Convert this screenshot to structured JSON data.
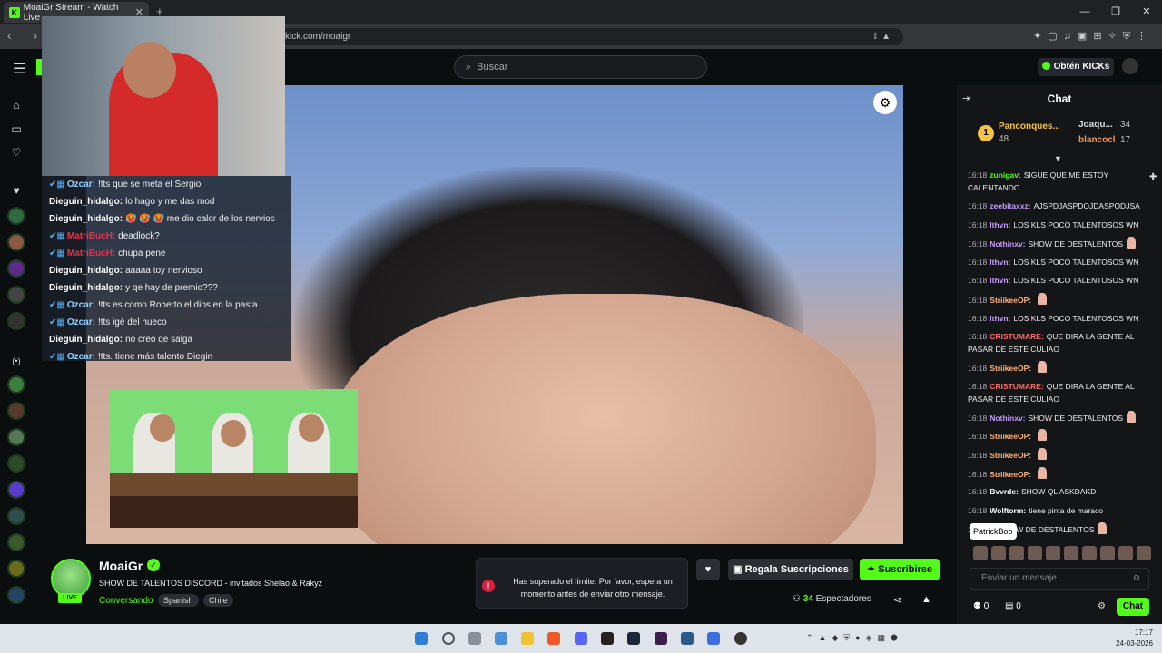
{
  "browser": {
    "tab_title": "MoaiGr Stream - Watch Live",
    "tab_close": "✕",
    "new_tab": "+",
    "url": "kick.com/moaigr",
    "window_controls": [
      "—",
      "❐",
      "✕"
    ]
  },
  "header": {
    "search_placeholder": "Buscar",
    "get_kicks": "Obtén KICKs"
  },
  "overlay_chat": [
    {
      "user": "Ozcar:",
      "text": "!tts que se meta el Sergio",
      "color": "#8fd1ff",
      "badge": true
    },
    {
      "user": "Dieguin_hidalgo:",
      "text": "lo hago y me das mod",
      "color": "#ffffff",
      "badge": false
    },
    {
      "user": "Dieguin_hidalgo:",
      "text": "🥵 🥵 🥵 me dio calor de los nervios",
      "color": "#ffffff",
      "badge": false
    },
    {
      "user": "MatriBucH:",
      "text": "deadlock?",
      "color": "#e2334a",
      "badge": true
    },
    {
      "user": "MatriBucH:",
      "text": "chupa pene",
      "color": "#e2334a",
      "badge": true
    },
    {
      "user": "Dieguin_hidalgo:",
      "text": "aaaaa toy nervioso",
      "color": "#ffffff",
      "badge": false
    },
    {
      "user": "Dieguin_hidalgo:",
      "text": "y qe hay de premio???",
      "color": "#ffffff",
      "badge": false
    },
    {
      "user": "Ozcar:",
      "text": "!tts es como Roberto el dios en la pasta",
      "color": "#8fd1ff",
      "badge": true
    },
    {
      "user": "Ozcar:",
      "text": "!tts igé del hueco",
      "color": "#8fd1ff",
      "badge": true
    },
    {
      "user": "Dieguin_hidalgo:",
      "text": "no creo qe salga",
      "color": "#ffffff",
      "badge": false
    },
    {
      "user": "Ozcar:",
      "text": "!tts. tiene más talento Diegin",
      "color": "#8fd1ff",
      "badge": true
    }
  ],
  "channel": {
    "name": "MoaiGr",
    "live": "LIVE",
    "title": "SHOW DE TALENTOS DISCORD - invitados Shelao & Rakyz",
    "category": "Conversando",
    "tags": [
      "Spanish",
      "Chile"
    ],
    "gift_subs": "Regala Suscripciones",
    "subscribe": "Suscribirse",
    "viewers_count": "34",
    "viewers_label": "Espectadores"
  },
  "toast": {
    "text": "Has superado el límite. Por favor, espera un momento antes de enviar otro mensaje."
  },
  "chat": {
    "title": "Chat",
    "leaderboard": {
      "rank": "1",
      "first_name": "Panconques...",
      "first_count": "48",
      "second_name": "Joaqu...",
      "second_count": "34",
      "third_name": "blancocl",
      "third_count": "17"
    },
    "messages": [
      {
        "time": "16:18",
        "user": "zunigav:",
        "text": "SIGUE QUE ME ESTOY CALENTANDO",
        "color": "#53fc18"
      },
      {
        "time": "16:18",
        "user": "zeebitaxxz:",
        "text": "AJSPDJASPDOJDASPODJSA",
        "color": "#c59bff"
      },
      {
        "time": "16:18",
        "user": "Ithvn:",
        "text": "LOS KLS POCO TALENTOSOS WN",
        "color": "#c59bff"
      },
      {
        "time": "16:18",
        "user": "Nothinxv:",
        "text": "SHOW DE DESTALENTOS",
        "color": "#c59bff"
      },
      {
        "time": "16:18",
        "user": "Ithvn:",
        "text": "LOS KLS POCO TALENTOSOS WN",
        "color": "#c59bff"
      },
      {
        "time": "16:18",
        "user": "Ithvn:",
        "text": "LOS KLS POCO TALENTOSOS WN",
        "color": "#c59bff"
      },
      {
        "time": "16:18",
        "user": "StriikeeOP:",
        "text": "",
        "color": "#ffb27a"
      },
      {
        "time": "16:18",
        "user": "Ithvn:",
        "text": "LOS KLS POCO TALENTOSOS WN",
        "color": "#c59bff"
      },
      {
        "time": "16:18",
        "user": "CRISTUMARE:",
        "text": "QUE DIRA LA GENTE AL PASAR DE ESTE CULIAO",
        "color": "#ff6b6b"
      },
      {
        "time": "16:18",
        "user": "StriikeeOP:",
        "text": "",
        "color": "#ffb27a"
      },
      {
        "time": "16:18",
        "user": "CRISTUMARE:",
        "text": "QUE DIRA LA GENTE AL PASAR DE ESTE CULIAO",
        "color": "#ff6b6b"
      },
      {
        "time": "16:18",
        "user": "Nothinxv:",
        "text": "SHOW DE DESTALENTOS",
        "color": "#c59bff"
      },
      {
        "time": "16:18",
        "user": "StriikeeOP:",
        "text": "",
        "color": "#ffb27a"
      },
      {
        "time": "16:18",
        "user": "StriikeeOP:",
        "text": "",
        "color": "#ffb27a"
      },
      {
        "time": "16:18",
        "user": "StriikeeOP:",
        "text": "",
        "color": "#ffb27a"
      },
      {
        "time": "16:18",
        "user": "Bvvrde:",
        "text": "SHOW QL ASKDAKD",
        "color": "#ffffff"
      },
      {
        "time": "16:18",
        "user": "Wolftorm:",
        "text": "tiene pinta de maraco",
        "color": "#ffffff"
      },
      {
        "time": "16:18",
        "user": "v:",
        "text": "SHOW DE DESTALENTOS",
        "color": "#c59bff"
      }
    ],
    "tooltip": "PatrickBoo",
    "input_placeholder": "Enviar un mensaje",
    "points": "0",
    "tokens": "0",
    "send": "Chat"
  },
  "taskbar": {
    "time": "17:17",
    "date": "24-03-2026"
  }
}
